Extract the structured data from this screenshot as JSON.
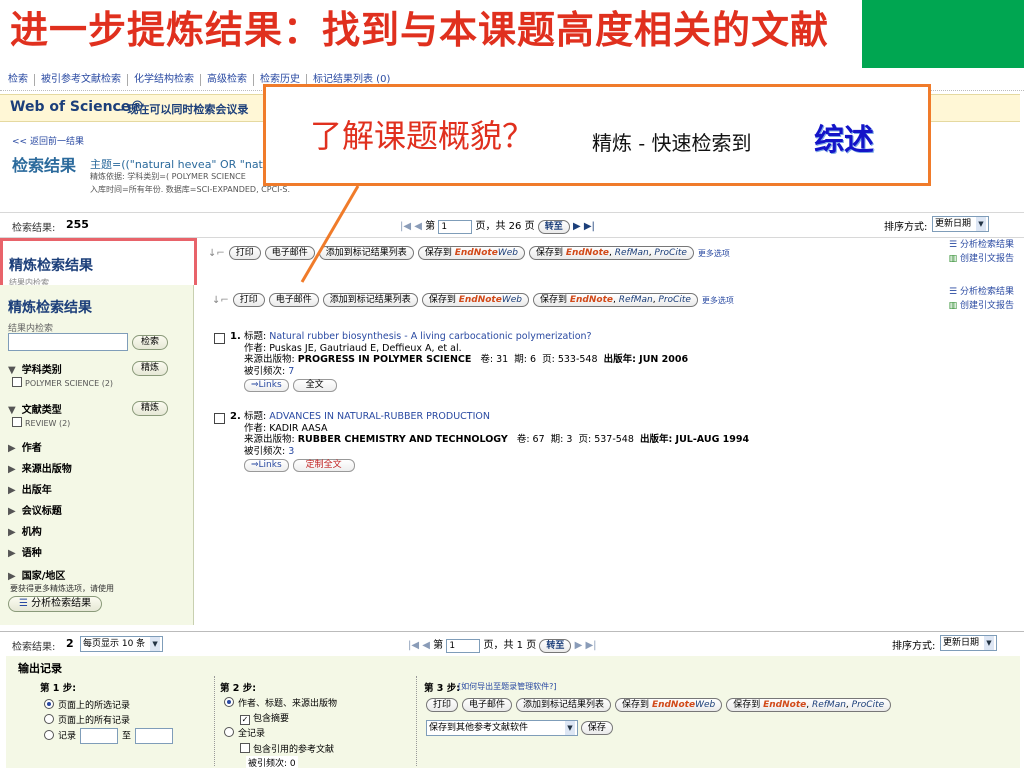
{
  "slide": {
    "title": "进一步提炼结果：找到与本课题高度相关的文献",
    "accent_color": "#e0301e",
    "corner_color": "#00a651"
  },
  "callout": {
    "main": "了解课题概貌？",
    "sub": "精炼 - 快速检索到",
    "highlight": "综述",
    "border_color": "#f07b2a"
  },
  "nav": {
    "items": [
      "检索",
      "被引参考文献检索",
      "化学结构检索",
      "高级检索",
      "检索历史",
      "标记结果列表 (0)"
    ]
  },
  "banner": {
    "logo": "Web of Science®",
    "note": "– 现在可以同时检索会议录"
  },
  "results_header": {
    "back": "<< 返回前一结果",
    "title": "检索结果",
    "topic": "主题=((\"natural hevea\" OR \"natural",
    "refined_by": "精炼依据: 学科类别=( POLYMER SCIENCE",
    "db_line": "入库时间=所有年份. 数据库=SCI-EXPANDED, CPCI-S."
  },
  "count_bar": {
    "label": "检索结果:",
    "total": "255",
    "prefix": "第",
    "page": "1",
    "of": "页，共 26 页",
    "go": "转至",
    "sort_label": "排序方式:",
    "sort_value": "更新日期"
  },
  "refine_old": {
    "title": "精炼检索结果",
    "hint": "结果内检索"
  },
  "toolbar": {
    "print": "打印",
    "email": "电子邮件",
    "add_marked": "添加到标记结果列表",
    "save_to": "保存到",
    "endnote": "EndNote",
    "web": "Web",
    "endnote2": "EndNote",
    "refman": "RefMan",
    "procite": "ProCite",
    "more": "更多选项",
    "analyze": "分析检索结果",
    "citation": "创建引文报告"
  },
  "sidebar": {
    "title": "精炼检索结果",
    "search_label": "结果内检索",
    "search_button": "检索",
    "refine": "精炼",
    "subject": "学科类别",
    "subject_opt": "POLYMER SCIENCE (2)",
    "doctype": "文献类型",
    "doctype_opt": "REVIEW (2)",
    "facets": [
      "作者",
      "来源出版物",
      "出版年",
      "会议标题",
      "机构",
      "语种",
      "国家/地区"
    ],
    "more_text": "要获得更多精炼选项，请使用",
    "analyze": "分析检索结果"
  },
  "records": [
    {
      "no": "1.",
      "title_label": "标题:",
      "title": "Natural rubber biosynthesis - A living carbocationic polymerization?",
      "authors_label": "作者:",
      "authors": "Puskas JE, Gautriaud E, Deffieux A, et al.",
      "source_label": "来源出版物:",
      "source": "PROGRESS IN POLYMER SCIENCE",
      "vol": "卷: 31",
      "issue": "期: 6",
      "pages": "页: 533-548",
      "year": "出版年: JUN 2006",
      "cited_label": "被引频次:",
      "cited": "7",
      "links": "Links",
      "fulltext": "全文"
    },
    {
      "no": "2.",
      "title_label": "标题:",
      "title": "ADVANCES IN NATURAL-RUBBER PRODUCTION",
      "authors_label": "作者:",
      "authors": "KADIR AASA",
      "source_label": "来源出版物:",
      "source": "RUBBER CHEMISTRY AND TECHNOLOGY",
      "vol": "卷: 67",
      "issue": "期: 3",
      "pages": "页: 537-548",
      "year": "出版年: JUL-AUG 1994",
      "cited_label": "被引频次:",
      "cited": "3",
      "links": "Links",
      "fulltext": "定制全文"
    }
  ],
  "bottom": {
    "label": "检索结果:",
    "total": "2",
    "per_page": "每页显示 10 条",
    "prefix": "第",
    "page": "1",
    "of": "页，共 1 页",
    "go": "转至",
    "sort_label": "排序方式:",
    "sort_value": "更新日期"
  },
  "output": {
    "title": "输出记录",
    "step1": "第 1 步:",
    "opt_selected": "页面上的所选记录",
    "opt_all": "页面上的所有记录",
    "opt_records": "记录",
    "to": "至",
    "step2": "第 2 步:",
    "opt_fields": "作者、标题、来源出版物",
    "opt_abstract": "包含摘要",
    "opt_full": "全记录",
    "opt_refs": "包含引用的参考文献",
    "step3": "第 3 步:",
    "howto": "[如何导出至题录管理软件?]",
    "export_select": "保存到其他参考文献软件",
    "save": "保存",
    "cited_bottom": "被引频次: 0"
  }
}
